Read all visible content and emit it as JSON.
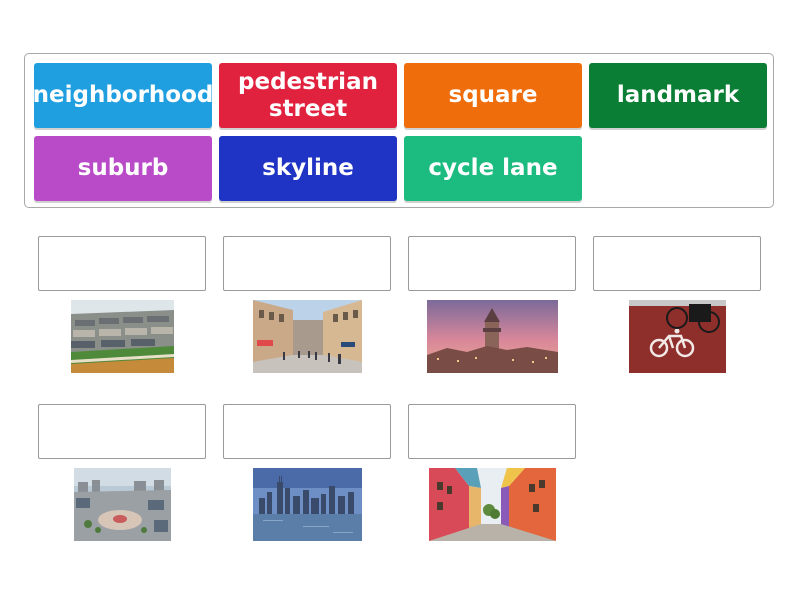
{
  "word_bank": {
    "tiles": [
      {
        "label": "neighborhood",
        "color": "#1f9fe0"
      },
      {
        "label": "pedestrian\nstreet",
        "color": "#e0223f"
      },
      {
        "label": "square",
        "color": "#f06d0b"
      },
      {
        "label": "landmark",
        "color": "#0a7e34"
      },
      {
        "label": "suburb",
        "color": "#b94bc9"
      },
      {
        "label": "skyline",
        "color": "#1f33c4"
      },
      {
        "label": "cycle lane",
        "color": "#1cbb80"
      }
    ]
  },
  "targets": [
    {
      "image": "suburb-aerial-photo",
      "answer": ""
    },
    {
      "image": "shopping-street-photo",
      "answer": ""
    },
    {
      "image": "tower-landmark-photo",
      "answer": ""
    },
    {
      "image": "bicycle-lane-photo",
      "answer": ""
    },
    {
      "image": "city-square-aerial-photo",
      "answer": ""
    },
    {
      "image": "city-skyline-photo",
      "answer": ""
    },
    {
      "image": "colorful-street-photo",
      "answer": ""
    }
  ]
}
